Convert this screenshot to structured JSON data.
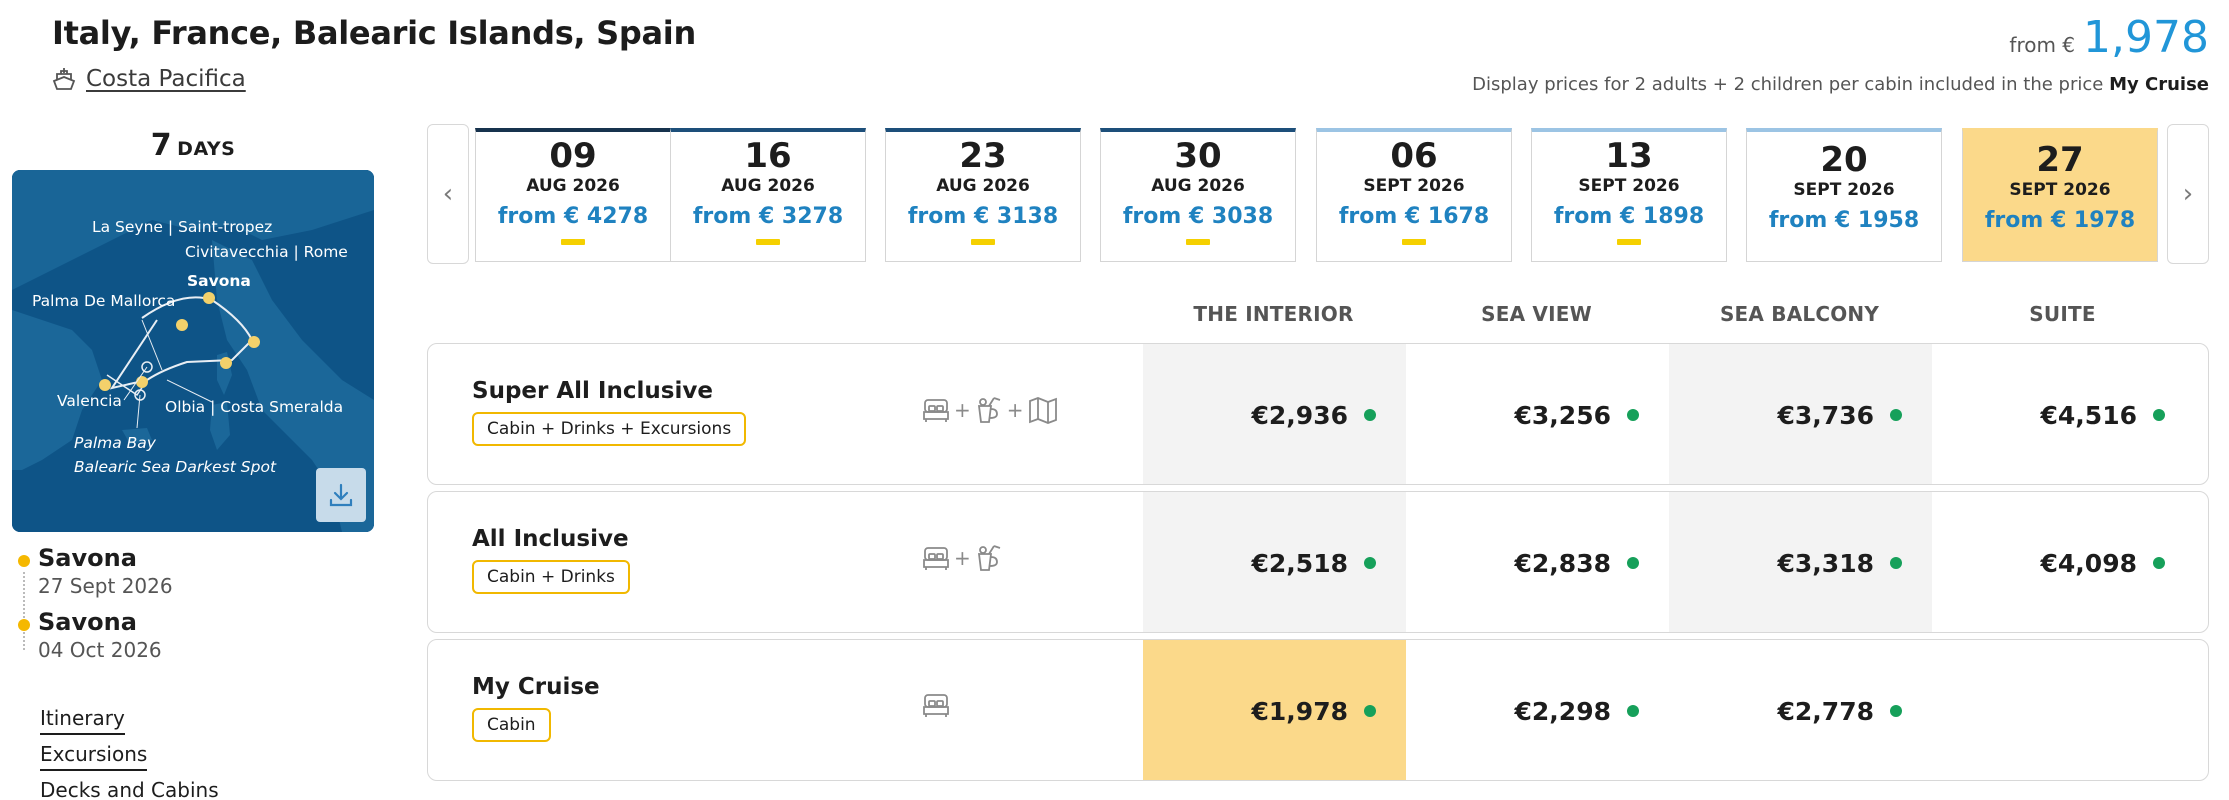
{
  "header": {
    "title": "Italy, France, Balearic Islands, Spain",
    "ship": "Costa Pacifica",
    "from_label": "from €",
    "from_value": "1,978",
    "display_note": "Display prices for 2 adults + 2 children per cabin included in the price",
    "display_note_bold": "My Cruise"
  },
  "left": {
    "days_num": "7",
    "days_unit": "DAYS",
    "map_labels": {
      "la_seyne": "La Seyne | Saint-tropez",
      "civitavecchia": "Civitavecchia | Rome",
      "savona": "Savona",
      "palma": "Palma De Mallorca",
      "valencia": "Valencia",
      "olbia": "Olbia | Costa Smeralda",
      "palma_bay": "Palma Bay",
      "balearic": "Balearic Sea Darkest Spot"
    },
    "stops": [
      {
        "port": "Savona",
        "date": "27 Sept 2026"
      },
      {
        "port": "Savona",
        "date": "04 Oct 2026"
      }
    ],
    "links": [
      "Itinerary",
      "Excursions",
      "Decks and Cabins"
    ]
  },
  "carousel": {
    "prev_icon": "‹",
    "next_icon": "›",
    "dates": [
      {
        "day": "09",
        "month": "AUG 2026",
        "price": "from € 4278"
      },
      {
        "day": "16",
        "month": "AUG 2026",
        "price": "from € 3278"
      },
      {
        "day": "23",
        "month": "AUG 2026",
        "price": "from € 3138"
      },
      {
        "day": "30",
        "month": "AUG 2026",
        "price": "from € 3038"
      },
      {
        "day": "06",
        "month": "SEPT 2026",
        "price": "from € 1678"
      },
      {
        "day": "13",
        "month": "SEPT 2026",
        "price": "from € 1898"
      },
      {
        "day": "20",
        "month": "SEPT 2026",
        "price": "from € 1958"
      },
      {
        "day": "27",
        "month": "SEPT 2026",
        "price": "from € 1978"
      }
    ]
  },
  "columns": [
    "THE INTERIOR",
    "SEA VIEW",
    "SEA BALCONY",
    "SUITE"
  ],
  "packages": [
    {
      "name": "Super All Inclusive",
      "tag": "Cabin + Drinks + Excursions",
      "prices": [
        "€2,936",
        "€3,256",
        "€3,736",
        "€4,516"
      ]
    },
    {
      "name": "All Inclusive",
      "tag": "Cabin + Drinks",
      "prices": [
        "€2,518",
        "€2,838",
        "€3,318",
        "€4,098"
      ]
    },
    {
      "name": "My Cruise",
      "tag": "Cabin",
      "prices": [
        "€1,978",
        "€2,298",
        "€2,778",
        ""
      ]
    }
  ],
  "icon_plus": "+",
  "colors": {
    "accent_blue": "#2196d8",
    "price_blue": "#1f82c0",
    "highlight": "#fbd98a",
    "tag_border": "#f1b800",
    "available_dot": "#16a05a",
    "map_sea": "#0e5487"
  }
}
